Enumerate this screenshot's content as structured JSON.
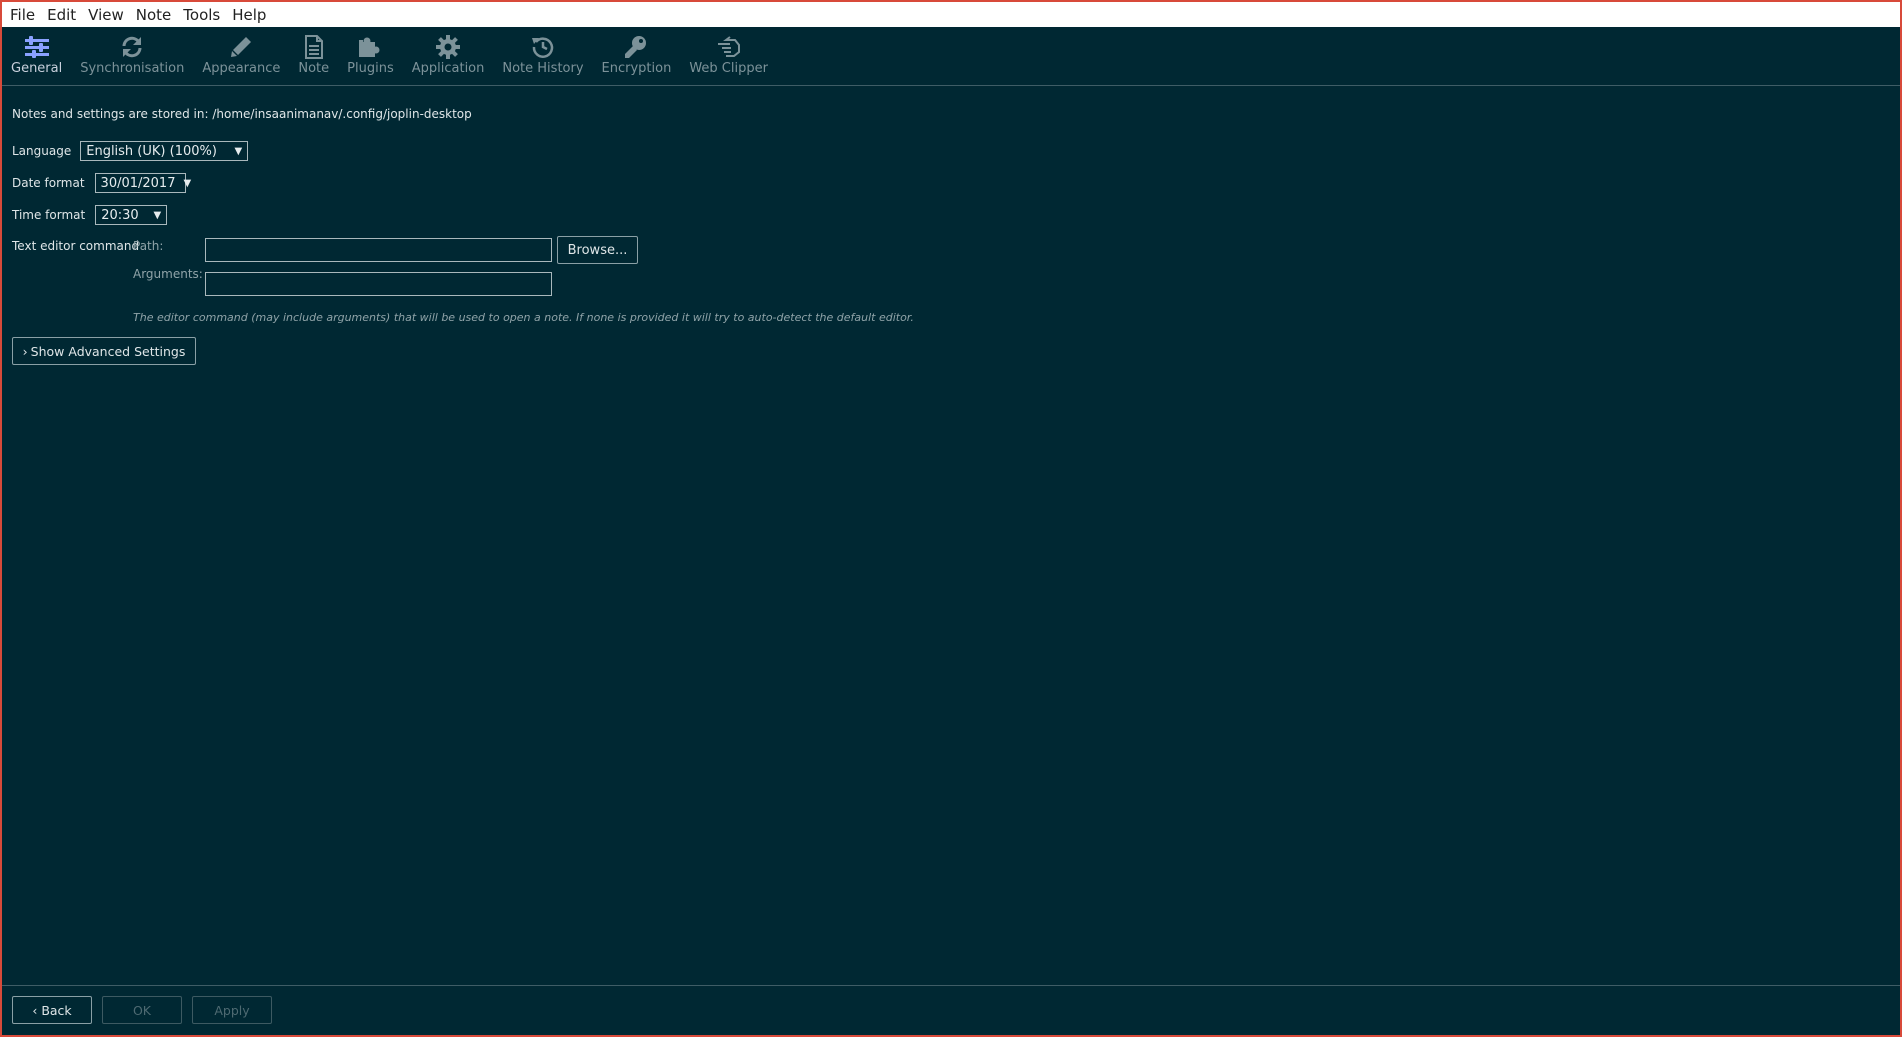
{
  "menubar": {
    "items": [
      "File",
      "Edit",
      "View",
      "Note",
      "Tools",
      "Help"
    ]
  },
  "tabs": [
    {
      "label": "General",
      "icon": "sliders-icon",
      "active": true
    },
    {
      "label": "Synchronisation",
      "icon": "sync-icon",
      "active": false
    },
    {
      "label": "Appearance",
      "icon": "pencil-icon",
      "active": false
    },
    {
      "label": "Note",
      "icon": "document-icon",
      "active": false
    },
    {
      "label": "Plugins",
      "icon": "puzzle-icon",
      "active": false
    },
    {
      "label": "Application",
      "icon": "gear-icon",
      "active": false
    },
    {
      "label": "Note History",
      "icon": "history-icon",
      "active": false
    },
    {
      "label": "Encryption",
      "icon": "key-icon",
      "active": false
    },
    {
      "label": "Web Clipper",
      "icon": "hand-pointer-icon",
      "active": false
    }
  ],
  "general": {
    "storage_note": "Notes and settings are stored in: /home/insaanimanav/.config/joplin-desktop",
    "language_label": "Language",
    "language_value": "English (UK) (100%)",
    "date_format_label": "Date format",
    "date_format_value": "30/01/2017",
    "time_format_label": "Time format",
    "time_format_value": "20:30",
    "editor_label": "Text editor command",
    "path_label": "Path:",
    "path_value": "",
    "arguments_label": "Arguments:",
    "arguments_value": "",
    "browse_label": "Browse...",
    "editor_hint": "The editor command (may include arguments) that will be used to open a note. If none is provided it will try to auto-detect the default editor.",
    "advanced_label": "Show Advanced Settings"
  },
  "footer": {
    "back_label": "Back",
    "ok_label": "OK",
    "apply_label": "Apply"
  },
  "colors": {
    "background": "#002833",
    "active_tab_icon": "#8aa1ff",
    "inactive_tab": "#7c9299",
    "window_border": "#d84a3a"
  }
}
